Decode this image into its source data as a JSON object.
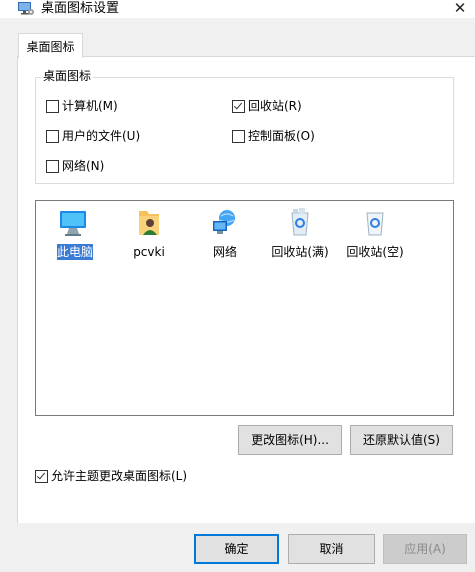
{
  "window": {
    "title": "桌面图标设置",
    "close_glyph": "✕",
    "app_icon": "desktop-settings-icon"
  },
  "tabs": [
    {
      "label": "桌面图标",
      "active": true
    }
  ],
  "desktop_icons_group": {
    "label": "桌面图标",
    "checkboxes": [
      {
        "label": "计算机(M)",
        "checked": false
      },
      {
        "label": "回收站(R)",
        "checked": true
      },
      {
        "label": "用户的文件(U)",
        "checked": false
      },
      {
        "label": "控制面板(O)",
        "checked": false
      },
      {
        "label": "网络(N)",
        "checked": false
      }
    ]
  },
  "icon_list": {
    "items": [
      {
        "label": "此电脑",
        "icon": "this-pc-icon",
        "selected": true
      },
      {
        "label": "pcvki",
        "icon": "user-folder-icon",
        "selected": false
      },
      {
        "label": "网络",
        "icon": "network-icon",
        "selected": false
      },
      {
        "label": "回收站(满)",
        "icon": "recycle-bin-full-icon",
        "selected": false
      },
      {
        "label": "回收站(空)",
        "icon": "recycle-bin-empty-icon",
        "selected": false
      }
    ]
  },
  "buttons": {
    "change_icon": "更改图标(H)...",
    "restore_default": "还原默认值(S)",
    "ok": "确定",
    "cancel": "取消",
    "apply": "应用(A)"
  },
  "allow_themes": {
    "label": "允许主题更改桌面图标(L)",
    "checked": true
  },
  "colors": {
    "selection": "#3a7bd5",
    "dialog_bg": "#f0f0f0",
    "default_button_border": "#0078d7"
  }
}
